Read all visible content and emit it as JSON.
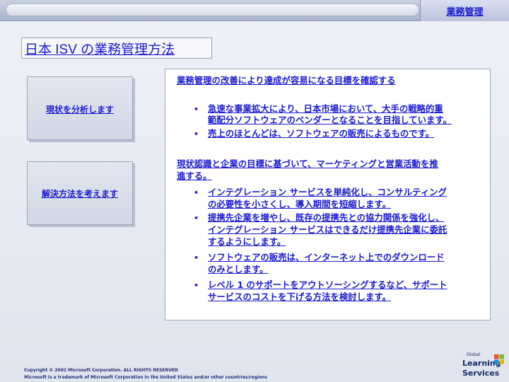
{
  "header": {
    "section_tab": "業務管理"
  },
  "title": "日本 ISV の業務管理方法",
  "side_boxes": {
    "analyze": "現状を分析します",
    "solve": "解決方法を考えます"
  },
  "panel": {
    "heading1": "業務管理の改善により達成が容易になる目標を確認する",
    "bullets1": [
      [
        "急速な事業拡大により、日本市場において、大手の戦略的重",
        "範配分ソフトウェアのベンダーとなることを目指しています。"
      ],
      [
        "売上のほとんどは、ソフトウェアの販売によるものです。"
      ]
    ],
    "heading2": [
      "現状認識と企業の目標に基づいて、マーケティングと営業活動を推",
      "進する。"
    ],
    "bullets2": [
      [
        "インテグレーション サービスを単純化し、コンサルティング",
        "の必要性を小さくし、導入期間を短縮します。"
      ],
      [
        "提携先企業を増やし、既存の提携先との協力関係を強化し、",
        "インテグレーション サービスはできるだけ提携先企業に委託",
        "するようにします。"
      ],
      [
        "ソフトウェアの販売は、インターネット上でのダウンロード",
        "のみとします。"
      ],
      [
        "レベル 1 のサポートをアウトソーシングするなど、サポート",
        "サービスのコストを下げる方法を検討します。"
      ]
    ],
    "bullet_symbol": "•"
  },
  "footer": {
    "copyright": "Copyright © 2002 Microsoft Corporation. ALL RIGHTS RESERVED",
    "trademark": "Microsoft is a trademark of Microsoft Corporation in the United States and/or other countries/regions"
  },
  "logo": {
    "line1": "Global",
    "line2": "Learning",
    "line3": "Services"
  },
  "colors": {
    "text": "#1b1bd1",
    "panel": "#ffffff",
    "background": "#e6eaf2"
  }
}
